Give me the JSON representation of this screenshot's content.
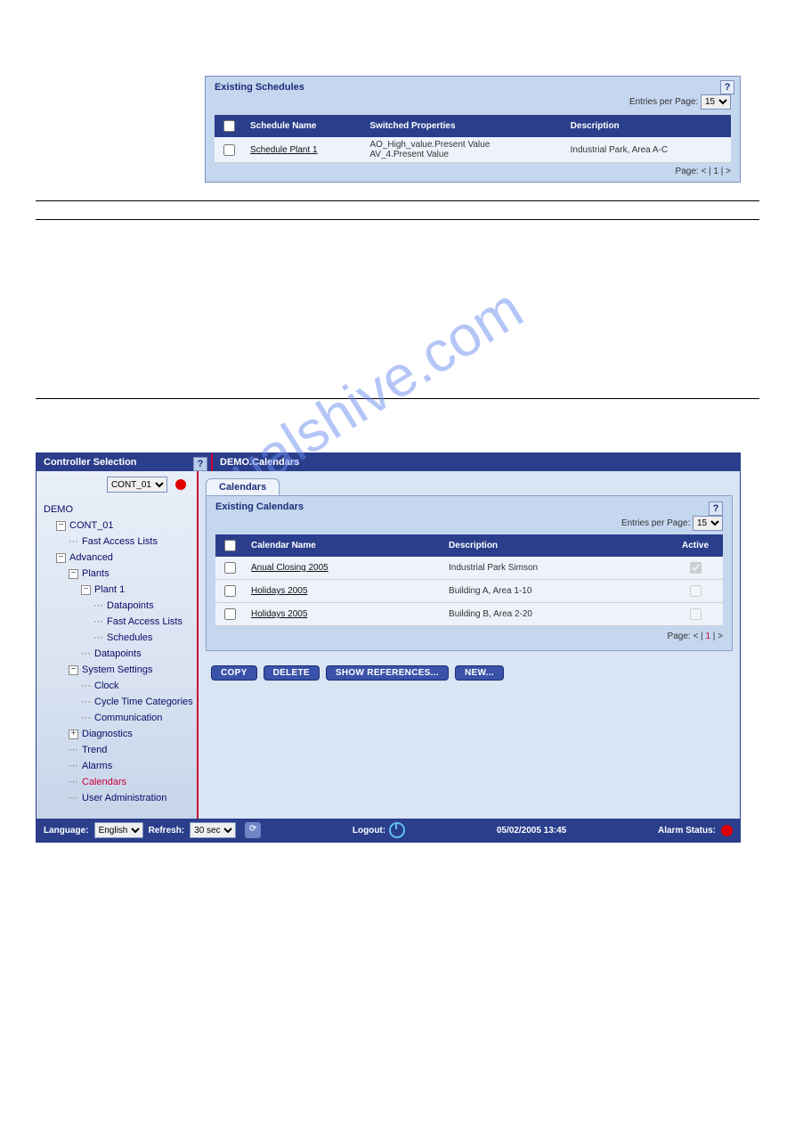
{
  "watermark": "manualshive.com",
  "topPanel": {
    "title": "Existing Schedules",
    "entriesLabel": "Entries per Page:",
    "entriesValue": "15",
    "cols": {
      "name": "Schedule Name",
      "sw": "Switched Properties",
      "desc": "Description"
    },
    "row": {
      "name": "Schedule Plant 1",
      "sw1": "AO_High_value.Present Value",
      "sw2": "AV_4.Present Value",
      "desc": "Industrial Park, Area A-C"
    },
    "pageLabel": "Page:  <  |  1  |  >"
  },
  "shot": {
    "top": {
      "left": "Controller Selection",
      "right": "DEMO.Calendars"
    },
    "tree": {
      "selector": "CONT_01",
      "root": "DEMO",
      "cont": "CONT_01",
      "fast": "Fast Access Lists",
      "adv": "Advanced",
      "plants": "Plants",
      "plant1": "Plant 1",
      "datapoints": "Datapoints",
      "fal": "Fast Access Lists",
      "schedules": "Schedules",
      "dp2": "Datapoints",
      "sys": "System Settings",
      "clock": "Clock",
      "cycle": "Cycle Time Categories",
      "comm": "Communication",
      "diag": "Diagnostics",
      "trend": "Trend",
      "alarms": "Alarms",
      "calendars": "Calendars",
      "user": "User Administration"
    },
    "tab": "Calendars",
    "pane": {
      "title": "Existing Calendars",
      "entriesLabel": "Entries per Page:",
      "entriesValue": "15",
      "cols": {
        "name": "Calendar Name",
        "desc": "Description",
        "active": "Active"
      },
      "rows": [
        {
          "name": "Anual Closing 2005",
          "desc": "Industrial Park Simson",
          "active": true
        },
        {
          "name": "Holidays 2005",
          "desc": "Building A, Area 1-10",
          "active": false
        },
        {
          "name": "Holidays 2005",
          "desc": "Building B, Area 2-20",
          "active": false
        }
      ],
      "page": {
        "pre": "Page:  <  | ",
        "cur": "1",
        "post": "  |  >"
      }
    },
    "buttons": {
      "copy": "COPY",
      "del": "DELETE",
      "showref": "SHOW REFERENCES...",
      "newb": "NEW..."
    },
    "status": {
      "langLabel": "Language:",
      "lang": "English",
      "refreshLabel": "Refresh:",
      "refresh": "30 sec",
      "logout": "Logout:",
      "dt": "05/02/2005 13:45",
      "alarm": "Alarm Status:"
    }
  }
}
